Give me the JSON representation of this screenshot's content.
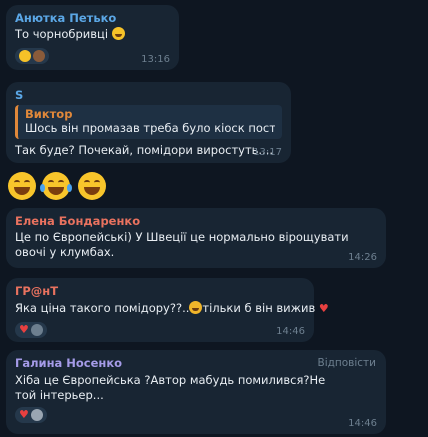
{
  "colors": {
    "background": "#0e1621",
    "bubble": "#182533",
    "name_blue": "#5ba7e6",
    "name_green": "#6fb86f",
    "name_red": "#e9725f",
    "name_purple": "#a59be8",
    "reply_orange": "#e0883a",
    "time_gray": "#6d7f8f"
  },
  "messages": [
    {
      "name": "Анютка Петько",
      "text": "То чорнобривці",
      "time": "13:16",
      "reactions": [
        "smile-face-icon",
        "avatar"
      ]
    },
    {
      "name": "S",
      "reply_author": "Виктор",
      "reply_text": "Шось він промазав треба було кіоск постав...",
      "text": "Так буде? Почекай, помідори виростуть....",
      "time": "13:17"
    },
    {
      "big_emoji": [
        "grin-face-icon",
        "tears-of-joy-icon",
        "grin-face-icon"
      ]
    },
    {
      "name": "Елена Бондаренко",
      "text": "Це по Європейські) У Швеції це нормально вірощувати овочі у клумбах.",
      "time": "14:26"
    },
    {
      "name": "ГР@нТ",
      "text_before": "Яка ціна такого помідору??..",
      "text_after": "тільки б він вижив",
      "time": "14:46",
      "reactions": [
        "heart-icon",
        "avatar"
      ]
    },
    {
      "name": "Галина Носенко",
      "reply_label": "Відповісти",
      "text": "Хіба це Європейська ?Автор мабудь помилився?Не той інтерьер...",
      "time": "14:46",
      "reactions": [
        "heart-icon",
        "avatar"
      ]
    }
  ]
}
